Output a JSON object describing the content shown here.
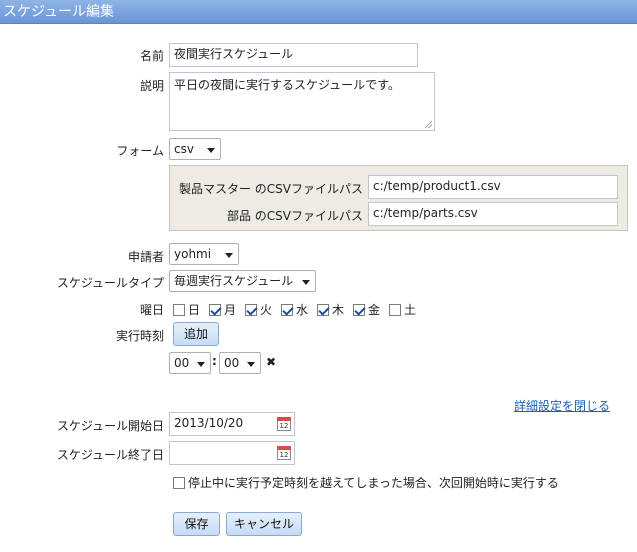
{
  "window": {
    "title": "スケジュール編集"
  },
  "form": {
    "name_label": "名前",
    "name_value": "夜間実行スケジュール",
    "desc_label": "説明",
    "desc_value": "平日の夜間に実行するスケジュールです。",
    "form_label": "フォーム",
    "form_value": "csv",
    "csv_panel": {
      "product_label": "製品マスター のCSVファイルパス",
      "product_value": "c:/temp/product1.csv",
      "parts_label": "部品 のCSVファイルパス",
      "parts_value": "c:/temp/parts.csv"
    },
    "requester_label": "申請者",
    "requester_value": "yohmi",
    "schedule_type_label": "スケジュールタイプ",
    "schedule_type_value": "毎週実行スケジュール",
    "weekday_label": "曜日",
    "weekdays": [
      {
        "label": "日",
        "checked": false
      },
      {
        "label": "月",
        "checked": true
      },
      {
        "label": "火",
        "checked": true
      },
      {
        "label": "水",
        "checked": true
      },
      {
        "label": "木",
        "checked": true
      },
      {
        "label": "金",
        "checked": true
      },
      {
        "label": "土",
        "checked": false
      }
    ],
    "exec_time_label": "実行時刻",
    "add_button": "追加",
    "hour_value": "00",
    "time_separator": ":",
    "minute_value": "00",
    "remove_icon_glyph": "✖",
    "detail_toggle_link": "詳細設定を閉じる",
    "start_date_label": "スケジュール開始日",
    "start_date_value": "2013/10/20",
    "end_date_label": "スケジュール終了日",
    "end_date_value": "",
    "calendar_icon_text": "12",
    "catchup_label": "停止中に実行予定時刻を越えてしまった場合、次回開始時に実行する",
    "catchup_checked": false,
    "save_button": "保存",
    "cancel_button": "キャンセル"
  },
  "icons": {
    "calendar": "calendar-icon",
    "remove": "remove-time-icon",
    "dropdown": "chevron-down-icon"
  },
  "colors": {
    "title_bar": "#7aa3e0",
    "panel_bg": "#eeebe4",
    "link": "#1a5fb4",
    "button_bg": "#d4e5f8"
  }
}
